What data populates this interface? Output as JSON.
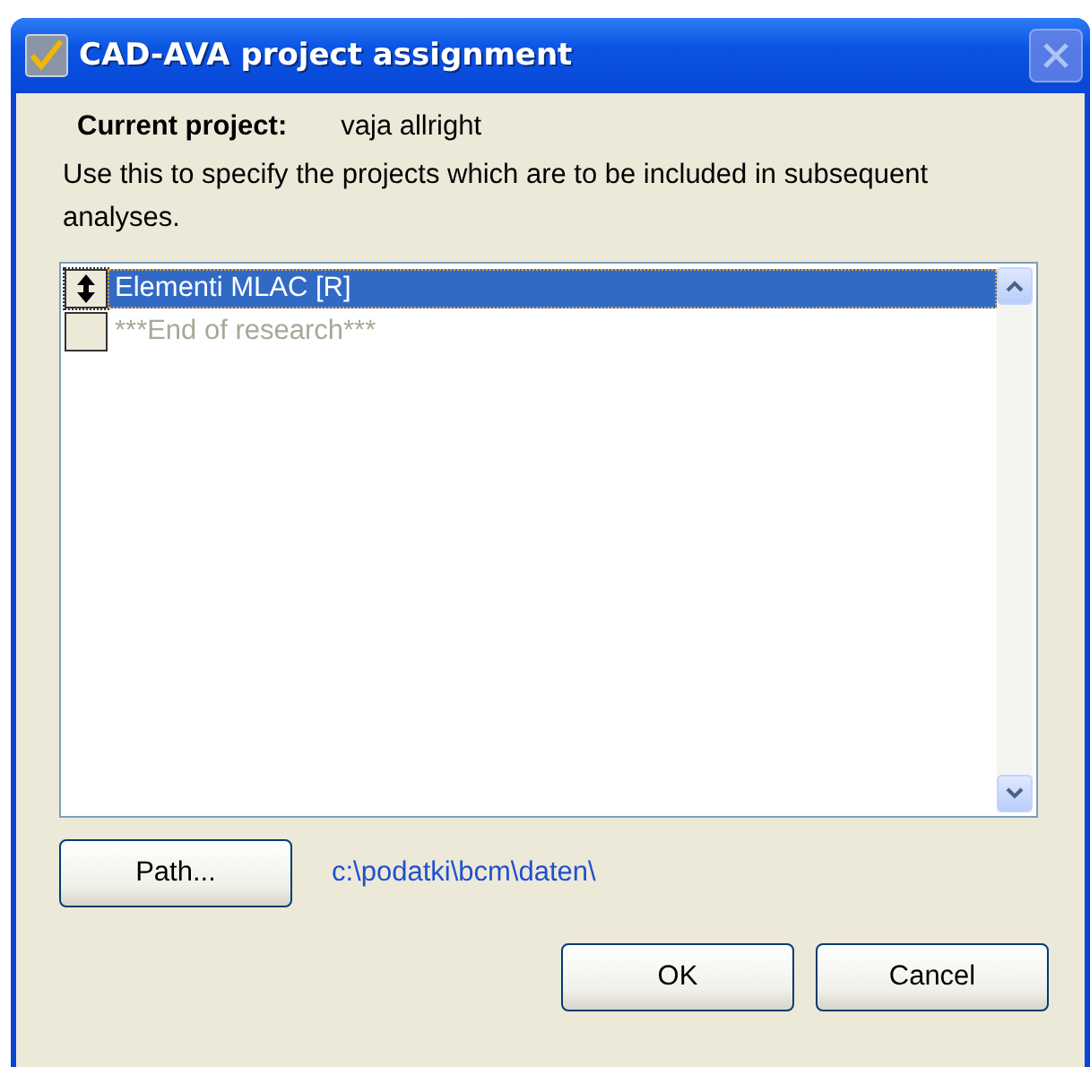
{
  "window": {
    "title": "CAD-AVA project assignment"
  },
  "current_project": {
    "label": "Current project:",
    "value": "vaja allright"
  },
  "description": "Use this to specify the projects which are to be included in subsequent analyses.",
  "projects": [
    {
      "name": "Elementi MLAC [R]",
      "selected": true,
      "disabled": false
    },
    {
      "name": "***End of research***",
      "selected": false,
      "disabled": true
    }
  ],
  "path": {
    "button": "Path...",
    "value": "c:\\podatki\\bcm\\daten\\"
  },
  "buttons": [
    {
      "label": "OK"
    },
    {
      "label": "Cancel"
    }
  ]
}
